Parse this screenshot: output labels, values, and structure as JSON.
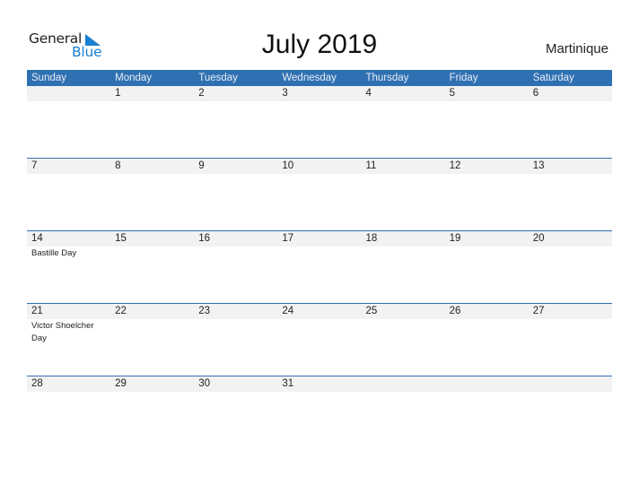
{
  "logo": {
    "line1": "General",
    "line2": "Blue"
  },
  "title": "July 2019",
  "country": "Martinique",
  "colors": {
    "header_bg": "#2f70b2",
    "strip_bg": "#f2f2f2",
    "logo_blue": "#1a7fd1"
  },
  "weekdays": [
    "Sunday",
    "Monday",
    "Tuesday",
    "Wednesday",
    "Thursday",
    "Friday",
    "Saturday"
  ],
  "weeks": [
    {
      "days": [
        "",
        "1",
        "2",
        "3",
        "4",
        "5",
        "6"
      ],
      "events": [
        "",
        "",
        "",
        "",
        "",
        "",
        ""
      ]
    },
    {
      "days": [
        "7",
        "8",
        "9",
        "10",
        "11",
        "12",
        "13"
      ],
      "events": [
        "",
        "",
        "",
        "",
        "",
        "",
        ""
      ]
    },
    {
      "days": [
        "14",
        "15",
        "16",
        "17",
        "18",
        "19",
        "20"
      ],
      "events": [
        "Bastille Day",
        "",
        "",
        "",
        "",
        "",
        ""
      ]
    },
    {
      "days": [
        "21",
        "22",
        "23",
        "24",
        "25",
        "26",
        "27"
      ],
      "events": [
        "Victor Shoelcher Day",
        "",
        "",
        "",
        "",
        "",
        ""
      ]
    },
    {
      "days": [
        "28",
        "29",
        "30",
        "31",
        "",
        "",
        ""
      ],
      "events": [
        "",
        "",
        "",
        "",
        "",
        "",
        ""
      ]
    }
  ]
}
